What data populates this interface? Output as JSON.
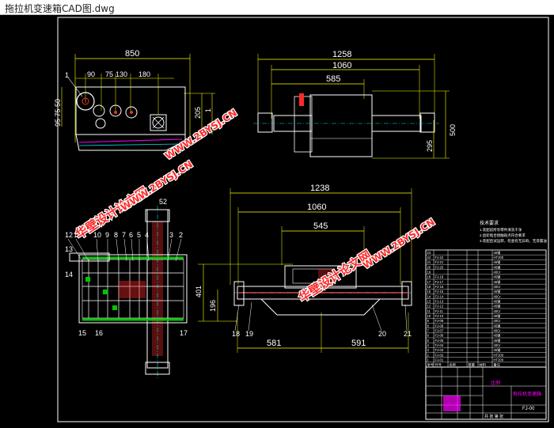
{
  "window": {
    "title": "拖拉机变速箱CAD图.dwg"
  },
  "colors": {
    "background": "#000000",
    "dimension": "#ffff00",
    "outline": "#ffffff",
    "watermark": "#ff2a2a",
    "green": "#00c800",
    "cyan": "#00e0e0",
    "magenta": "#ff00ff"
  },
  "view_top_left": {
    "dims": {
      "width": "850",
      "d90": "90",
      "d75": "75",
      "d130": "130",
      "d180": "180",
      "h205": "205",
      "hv50": "95 75 50",
      "h1": "1",
      "label1": "1"
    }
  },
  "view_top_right": {
    "dims": {
      "d1258": "1258",
      "d1060": "1060",
      "d585": "585",
      "d500": "500",
      "d295": "295"
    }
  },
  "view_bottom_left": {
    "part_numbers_top": [
      "12",
      "11",
      "10",
      "9",
      "8",
      "7",
      "6",
      "5",
      "4",
      "3",
      "2"
    ],
    "labels": {
      "p13": "13",
      "p14": "14",
      "p15": "15",
      "p16": "16",
      "p17": "17",
      "d52": "52"
    }
  },
  "view_bottom_mid": {
    "dims": {
      "d1238": "1238",
      "d1060": "1060",
      "d545": "545",
      "d401": "401",
      "d196": "196",
      "d581": "581",
      "d591": "591"
    },
    "labels": {
      "p18": "18",
      "p19": "19",
      "p20": "20",
      "p21": "21"
    }
  },
  "tech_notes": {
    "title": "技术要求",
    "lines": [
      "1.装配前所有零件清洗干净",
      "2.齿轮啮合接触斑点符合要求",
      "3.装配后试运转，检查有无异响，无渗漏油"
    ]
  },
  "bom": {
    "rows": [
      [
        "23",
        "",
        "",
        "",
        "",
        "45钢"
      ],
      [
        "22",
        "FJ-22",
        "",
        "",
        "",
        "HT200"
      ],
      [
        "21",
        "FJ-21",
        "",
        "",
        "",
        "45钢"
      ],
      [
        "20",
        "FJ-20",
        "",
        "",
        "",
        "45钢"
      ],
      [
        "19",
        "",
        "",
        "",
        "",
        "40Cr"
      ],
      [
        "18",
        "FJ-18",
        "",
        "",
        "",
        "45钢"
      ],
      [
        "17",
        "FJ-17",
        "",
        "",
        "",
        "45钢"
      ],
      [
        "16",
        "FJ-16",
        "",
        "",
        "",
        "40Cr"
      ],
      [
        "15",
        "FJ-15",
        "",
        "",
        "",
        "45钢"
      ],
      [
        "14",
        "FJ-14",
        "",
        "",
        "",
        "40Cr"
      ],
      [
        "13",
        "FJ-13",
        "",
        "",
        "",
        "45钢"
      ],
      [
        "12",
        "FJ-12",
        "",
        "",
        "",
        "45钢"
      ],
      [
        "11",
        "FJ-11",
        "",
        "",
        "",
        "40Cr"
      ],
      [
        "10",
        "FJ-10",
        "",
        "",
        "",
        "45钢"
      ],
      [
        "9",
        "FJ-09",
        "",
        "",
        "",
        "40Cr"
      ],
      [
        "8",
        "FJ-08",
        "",
        "",
        "",
        "45钢"
      ],
      [
        "7",
        "FJ-07",
        "",
        "",
        "",
        "40Cr"
      ],
      [
        "6",
        "FJ-06",
        "",
        "",
        "",
        "45钢"
      ],
      [
        "5",
        "FJ-05",
        "",
        "",
        "",
        "45钢"
      ],
      [
        "4",
        "FJ-04",
        "",
        "",
        "",
        "40Cr"
      ],
      [
        "3",
        "FJ-03",
        "",
        "",
        "",
        "45钢"
      ],
      [
        "2",
        "FJ-02",
        "",
        "",
        "",
        "HT200"
      ],
      [
        "1",
        "FJ-01",
        "",
        "",
        "",
        "HT200"
      ]
    ],
    "header": [
      "序号",
      "代号",
      "名称",
      "数量",
      "材料",
      "备注"
    ]
  },
  "title_block": {
    "name": "拖拉机变速箱",
    "code": "FJ-00",
    "scale_label": "比例",
    "sheet": "共 张 第 张"
  },
  "watermarks": [
    {
      "text": "华壁设计论文网"
    },
    {
      "text": "WWW.2BYSJ.CN"
    },
    {
      "text": "WWW.2BYSJ.CN"
    },
    {
      "text": "华壁设计论文网"
    },
    {
      "text": "WWW.2BYSJ.CN"
    }
  ]
}
